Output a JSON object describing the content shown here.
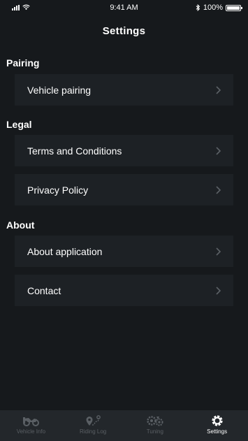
{
  "status_bar": {
    "time": "9:41 AM",
    "battery": "100%",
    "battery_level": 1.0
  },
  "nav": {
    "title": "Settings"
  },
  "sections": [
    {
      "header": "Pairing",
      "items": [
        {
          "label": "Vehicle pairing"
        }
      ]
    },
    {
      "header": "Legal",
      "items": [
        {
          "label": "Terms and Conditions"
        },
        {
          "label": "Privacy Policy"
        }
      ]
    },
    {
      "header": "About",
      "items": [
        {
          "label": "About application"
        },
        {
          "label": "Contact"
        }
      ]
    }
  ],
  "tab_bar": {
    "tabs": [
      {
        "label": "Vehicle Info",
        "icon": "motorcycle-icon",
        "active": false
      },
      {
        "label": "Riding Log",
        "icon": "route-icon",
        "active": false
      },
      {
        "label": "Tuning",
        "icon": "gears-icon",
        "active": false
      },
      {
        "label": "Settings",
        "icon": "gear-icon",
        "active": true
      }
    ]
  },
  "colors": {
    "background": "#16191c",
    "row_background": "#1d2125",
    "tab_bar": "#23272b",
    "inactive_tab": "#5a5f64",
    "active_tab": "#ffffff"
  }
}
